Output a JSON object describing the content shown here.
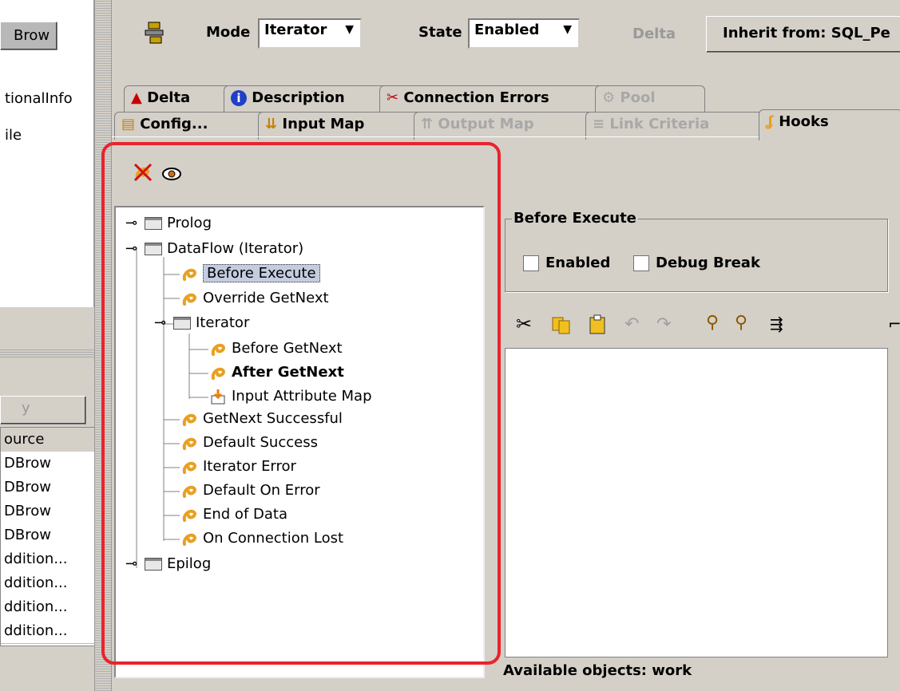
{
  "left_panel": {
    "top_button": "Brow",
    "items": [
      "tionalInfo",
      "ile"
    ],
    "tab_stub": "y",
    "table_header": "ource",
    "table_rows": [
      "DBrow",
      "DBrow",
      "DBrow",
      "DBrow",
      "ddition...",
      "ddition...",
      "ddition...",
      "ddition..."
    ]
  },
  "toolbar": {
    "mode_label": "Mode",
    "mode_value": "Iterator",
    "state_label": "State",
    "state_value": "Enabled",
    "delta_button": "Delta",
    "inherit_button": "Inherit from: SQL_Pe"
  },
  "tabs_row1": [
    "Delta",
    "Description",
    "Connection Errors",
    "Pool"
  ],
  "tabs_row2": [
    "Config...",
    "Input Map",
    "Output Map",
    "Link Criteria",
    "Hooks"
  ],
  "tree": {
    "prolog": "Prolog",
    "dataflow": "DataFlow (Iterator)",
    "before_execute": "Before Execute",
    "override_getnext": "Override GetNext",
    "iterator": "Iterator",
    "before_getnext": "Before GetNext",
    "after_getnext": "After GetNext",
    "input_attribute_map": "Input Attribute Map",
    "getnext_successful": "GetNext Successful",
    "default_success": "Default Success",
    "iterator_error": "Iterator Error",
    "default_on_error": "Default On Error",
    "end_of_data": "End of Data",
    "on_connection_lost": "On Connection Lost",
    "epilog": "Epilog"
  },
  "hook_panel": {
    "group_title": "Before Execute",
    "enabled_label": "Enabled",
    "debug_break_label": "Debug Break",
    "status_text": "Available objects: work"
  },
  "colors": {
    "highlight": "#e8242e",
    "panel_bg": "#d4d0c8",
    "selection_bg": "#c4cce0",
    "hook_icon": "#e8a020"
  }
}
